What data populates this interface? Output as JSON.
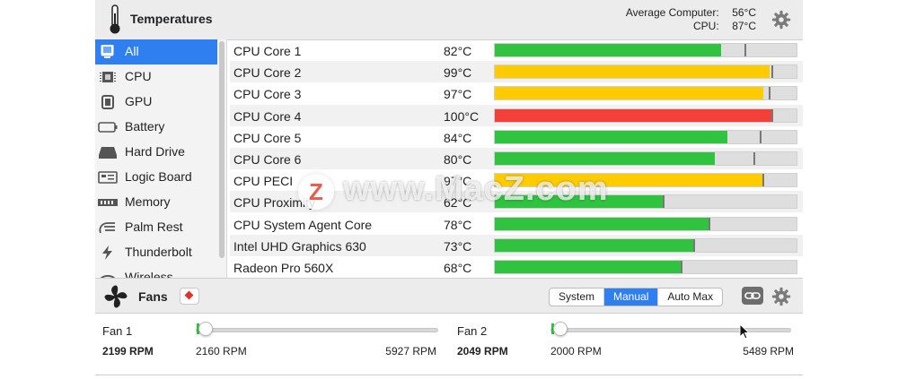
{
  "header": {
    "title": "Temperatures",
    "avg_label": "Average Computer:",
    "avg_value": "56°C",
    "cpu_label": "CPU:",
    "cpu_value": "87°C"
  },
  "sidebar": {
    "items": [
      {
        "label": "All",
        "icon": "all-icon",
        "selected": true
      },
      {
        "label": "CPU",
        "icon": "cpu-icon",
        "selected": false
      },
      {
        "label": "GPU",
        "icon": "gpu-icon",
        "selected": false
      },
      {
        "label": "Battery",
        "icon": "battery-icon",
        "selected": false
      },
      {
        "label": "Hard Drive",
        "icon": "hard-drive-icon",
        "selected": false
      },
      {
        "label": "Logic Board",
        "icon": "logic-board-icon",
        "selected": false
      },
      {
        "label": "Memory",
        "icon": "memory-icon",
        "selected": false
      },
      {
        "label": "Palm Rest",
        "icon": "palm-rest-icon",
        "selected": false
      },
      {
        "label": "Thunderbolt",
        "icon": "thunderbolt-icon",
        "selected": false
      },
      {
        "label": "Wireless",
        "icon": "wireless-icon",
        "selected": false
      }
    ]
  },
  "sensors": [
    {
      "name": "CPU Core 1",
      "temp": "82°C",
      "level": 0.75,
      "marker": 0.83,
      "color": "#2fc340"
    },
    {
      "name": "CPU Core 2",
      "temp": "99°C",
      "level": 0.91,
      "marker": 0.92,
      "color": "#ffcc00"
    },
    {
      "name": "CPU Core 3",
      "temp": "97°C",
      "level": 0.89,
      "marker": 0.91,
      "color": "#ffcc00"
    },
    {
      "name": "CPU Core 4",
      "temp": "100°C",
      "level": 0.92,
      "marker": 0.92,
      "color": "#f3403a"
    },
    {
      "name": "CPU Core 5",
      "temp": "84°C",
      "level": 0.77,
      "marker": 0.88,
      "color": "#2fc340"
    },
    {
      "name": "CPU Core 6",
      "temp": "80°C",
      "level": 0.73,
      "marker": 0.86,
      "color": "#2fc340"
    },
    {
      "name": "CPU PECI",
      "temp": "97°C",
      "level": 0.89,
      "marker": 0.89,
      "color": "#ffcc00"
    },
    {
      "name": "CPU Proximity",
      "temp": "62°C",
      "level": 0.56,
      "marker": 0.56,
      "color": "#2fc340"
    },
    {
      "name": "CPU System Agent Core",
      "temp": "78°C",
      "level": 0.71,
      "marker": 0.71,
      "color": "#2fc340"
    },
    {
      "name": "Intel UHD Graphics 630",
      "temp": "73°C",
      "level": 0.66,
      "marker": 0.66,
      "color": "#2fc340"
    },
    {
      "name": "Radeon Pro 560X",
      "temp": "68°C",
      "level": 0.62,
      "marker": 0.62,
      "color": "#2fc340"
    }
  ],
  "watermark": {
    "logo": "Z",
    "text": "www.MacZ.com"
  },
  "fans": {
    "title": "Fans",
    "modes": [
      "System",
      "Manual",
      "Auto Max"
    ],
    "active_mode": "Manual",
    "items": [
      {
        "name": "Fan 1",
        "rpm": "2199 RPM",
        "min": "2160 RPM",
        "max": "5927 RPM",
        "level": 0.01
      },
      {
        "name": "Fan 2",
        "rpm": "2049 RPM",
        "min": "2000 RPM",
        "max": "5489 RPM",
        "level": 0.01
      }
    ]
  },
  "colors": {
    "accent": "#2f7ff0",
    "green": "#2fc340",
    "yellow": "#ffcc00",
    "red": "#f3403a"
  }
}
